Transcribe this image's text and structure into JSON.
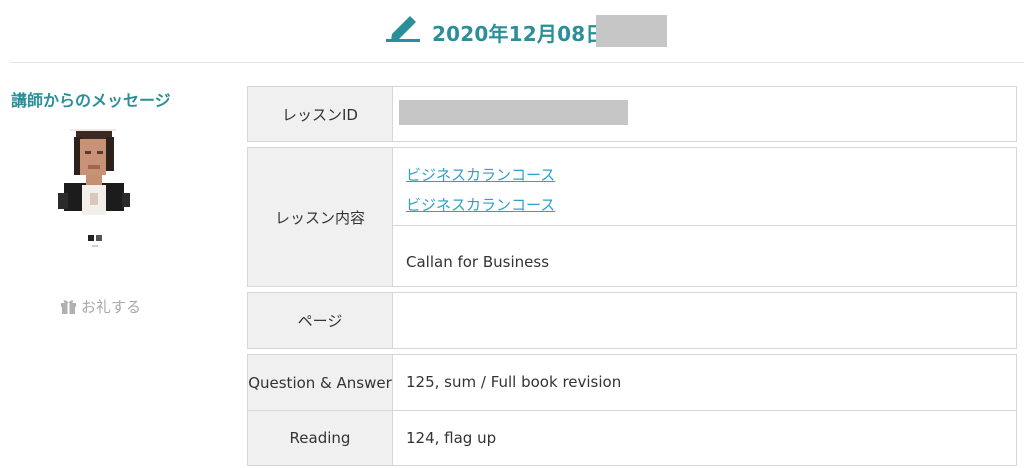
{
  "header": {
    "date": "2020年12月08日",
    "icon": "pencil-icon",
    "accent_color": "#2a8f98"
  },
  "sidebar": {
    "message_title": "講師からのメッセージ",
    "thanks_label": "お礼する",
    "thanks_icon": "gift-icon"
  },
  "lesson_id": {
    "label": "レッスンID"
  },
  "lesson_content": {
    "label": "レッスン内容",
    "links": [
      "ビジネスカランコース",
      "ビジネスカランコース"
    ],
    "course_name": "Callan for Business",
    "link_color": "#2fa0c8"
  },
  "page": {
    "label": "ページ",
    "value": ""
  },
  "qa": {
    "label": "Question & Answer",
    "value": "125, sum / Full book revision"
  },
  "reading": {
    "label": "Reading",
    "value": "124, flag up"
  }
}
